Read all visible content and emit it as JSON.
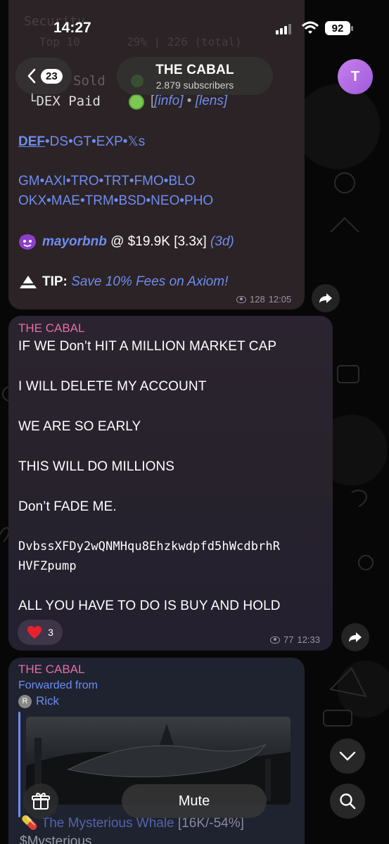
{
  "status_bar": {
    "time": "14:27",
    "battery": "92"
  },
  "header": {
    "back_badge": "23",
    "title": "THE CABAL",
    "subtitle": "2.879 subscribers",
    "avatar_letter": "T"
  },
  "msg1": {
    "faded_top_left": "Security",
    "faded_top2": "Top 10",
    "faded_top2_val": "29% | 226 (total)",
    "faded_sold": "Sold",
    "dex_paid_label": "└DEX Paid",
    "dex_info": "[info]",
    "dex_sep": "•",
    "dex_lens": "[lens]",
    "links_row1": [
      "DEF",
      "DS",
      "GT",
      "EXP",
      "𝕏s"
    ],
    "links_row2": [
      "GM",
      "AXI",
      "TRO",
      "TRT",
      "FMO",
      "BLO"
    ],
    "links_row3": [
      "OKX",
      "MAE",
      "TRM",
      "BSD",
      "NEO",
      "PHO"
    ],
    "caller_name": "mayorbnb",
    "caller_rest": "@ $19.9K [3.3x]",
    "caller_age": "(3d)",
    "tip_label": "TIP:",
    "tip_text": "Save 10% Fees on Axiom!",
    "views": "128",
    "time": "12:05"
  },
  "msg2": {
    "sender": "THE CABAL",
    "lines": [
      "IF WE Don’t HIT A MILLION MARKET CAP",
      "I WILL DELETE MY ACCOUNT",
      "WE ARE SO EARLY",
      "THIS WILL DO MILLIONS",
      "Don’t FADE ME.",
      "DvbssXFDy2wQNMHqu8Ehzkwdpfd5hWcdbrhR",
      "HVFZpump",
      "ALL YOU HAVE TO DO IS BUY AND HOLD"
    ],
    "reaction_count": "3",
    "views": "77",
    "time": "12:33"
  },
  "msg3": {
    "sender": "THE CABAL",
    "forwarded_label": "Forwarded from",
    "forwarded_initial": "R",
    "forwarded_name": "Rick",
    "bottom_title": "The Mysterious Whale",
    "bottom_stats": "[16K/-54%]",
    "bottom_ticker": "$Mysterious"
  },
  "bottom_bar": {
    "mute_label": "Mute"
  }
}
